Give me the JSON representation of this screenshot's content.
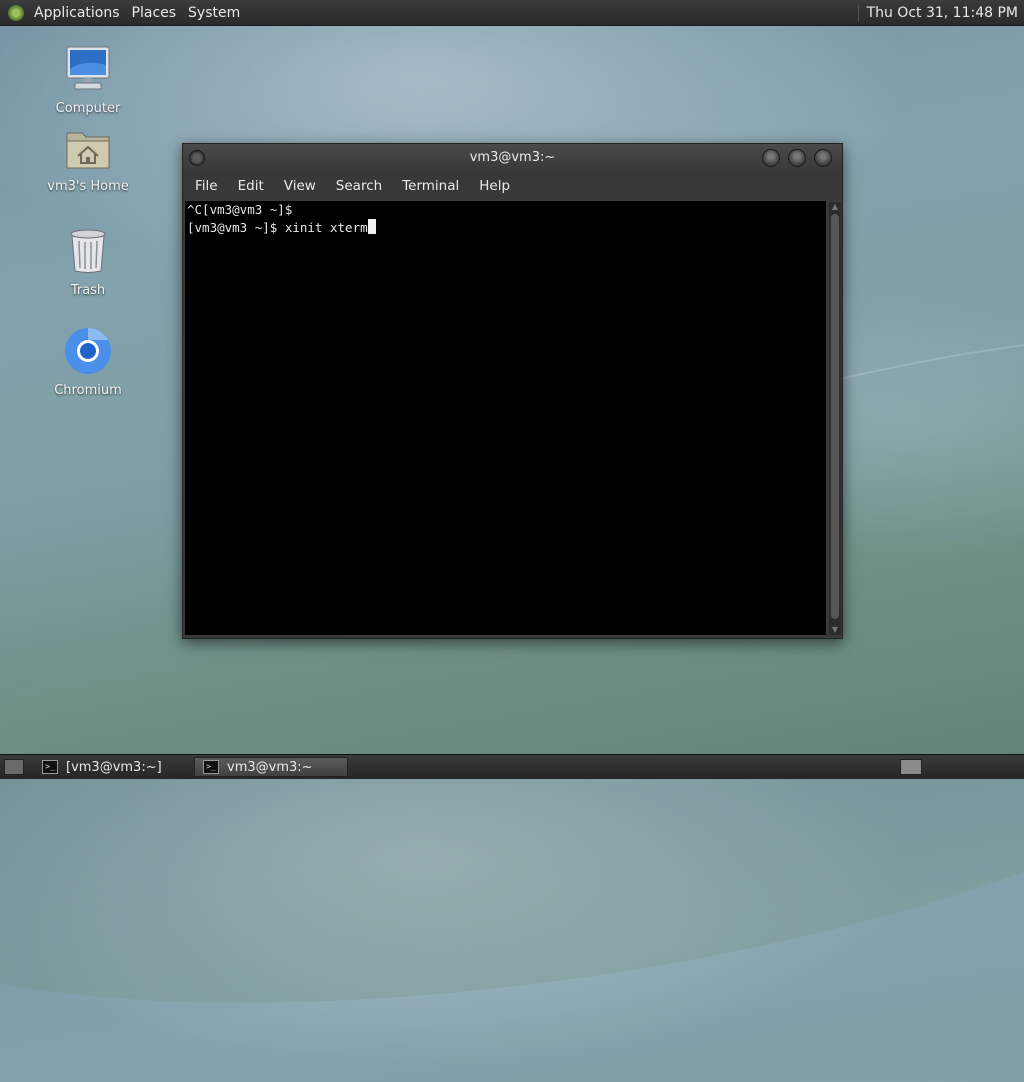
{
  "top_panel": {
    "menus": [
      "Applications",
      "Places",
      "System"
    ],
    "clock": "Thu Oct 31, 11:48 PM"
  },
  "desktop_icons": [
    {
      "label": "Computer",
      "icon": "computer-icon"
    },
    {
      "label": "vm3's Home",
      "icon": "home-folder-icon"
    },
    {
      "label": "Trash",
      "icon": "trash-icon"
    },
    {
      "label": "Chromium",
      "icon": "chromium-icon"
    }
  ],
  "terminal": {
    "title": "vm3@vm3:~",
    "menu": [
      "File",
      "Edit",
      "View",
      "Search",
      "Terminal",
      "Help"
    ],
    "lines": [
      "^C[vm3@vm3 ~]$",
      "[vm3@vm3 ~]$ xinit xterm"
    ]
  },
  "taskbar": {
    "tasks": [
      {
        "label": "[vm3@vm3:~]",
        "active": false
      },
      {
        "label": "vm3@vm3:~",
        "active": true
      }
    ]
  },
  "colors": {
    "panel": "#2e2e2e",
    "terminal_bg": "#000000",
    "terminal_fg": "#e6e6e6",
    "chromium_blue": "#3b82e0"
  }
}
